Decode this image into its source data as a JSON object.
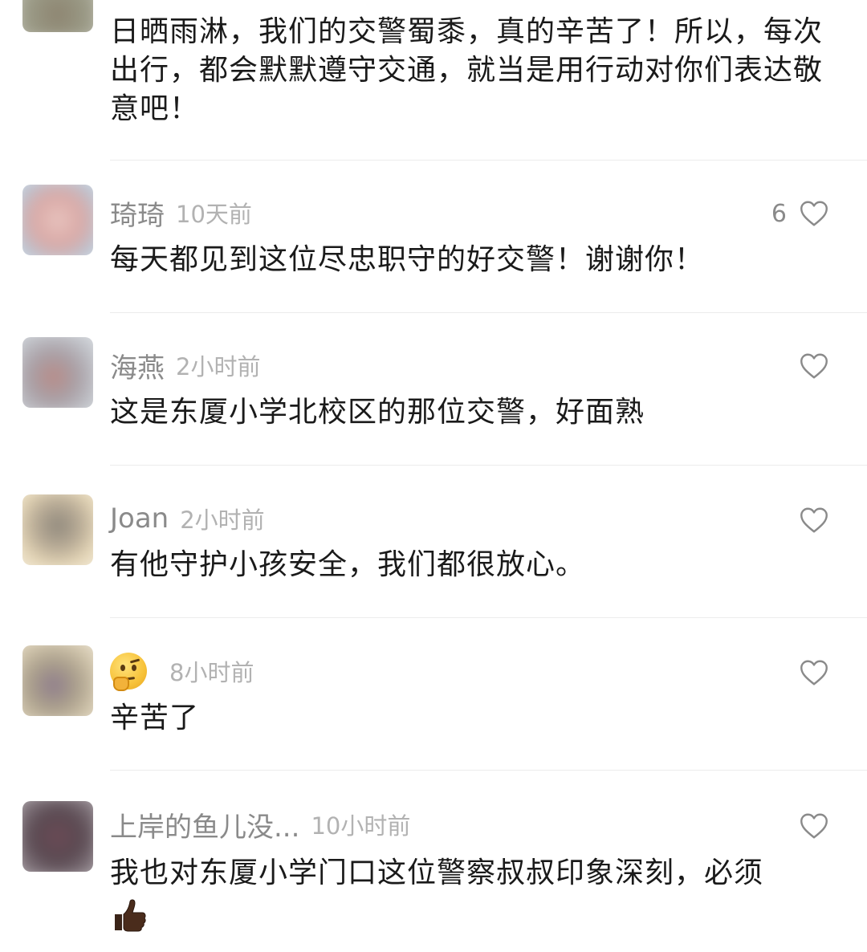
{
  "comments": [
    {
      "username": "",
      "time": "",
      "likes": "",
      "text": "日晒雨淋，我们的交警蜀黍，真的辛苦了！所以，每次出行，都会默默遵守交通，就当是用行动对你们表达敬意吧！"
    },
    {
      "username": "琦琦",
      "time": "10天前",
      "likes": "6",
      "text": "每天都见到这位尽忠职守的好交警！谢谢你！"
    },
    {
      "username": "海燕",
      "time": "2小时前",
      "likes": "",
      "text": "这是东厦小学北校区的那位交警，好面熟"
    },
    {
      "username": "Joan",
      "time": "2小时前",
      "likes": "",
      "text": "有他守护小孩安全，我们都很放心。"
    },
    {
      "username": "",
      "username_icon": "thinking-face-emoji",
      "time": "8小时前",
      "likes": "",
      "text": "辛苦了"
    },
    {
      "username": "上岸的鱼儿没...",
      "time": "10小时前",
      "likes": "",
      "text": "我也对东厦小学门口这位警察叔叔印象深刻，必须",
      "trailing_icon": "thumbs-up-emoji"
    }
  ]
}
